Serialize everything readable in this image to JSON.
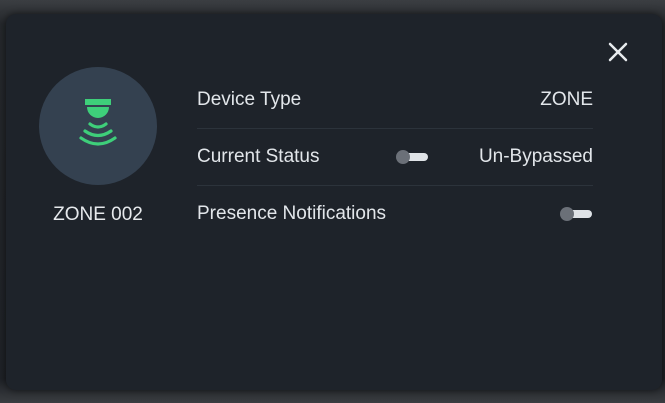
{
  "dialog": {
    "close_icon": "close-icon",
    "device": {
      "icon": "presence-sensor-icon",
      "name": "ZONE 002"
    },
    "rows": {
      "device_type": {
        "label": "Device Type",
        "value": "ZONE"
      },
      "current_status": {
        "label": "Current Status",
        "value": "Un-Bypassed",
        "toggle_on": false
      },
      "presence_notifications": {
        "label": "Presence Notifications",
        "toggle_on": false
      }
    }
  },
  "colors": {
    "card_background": "#1e232a",
    "avatar_background": "#344150",
    "icon_accent": "#3ecf7a",
    "text": "#e2e6ea"
  }
}
